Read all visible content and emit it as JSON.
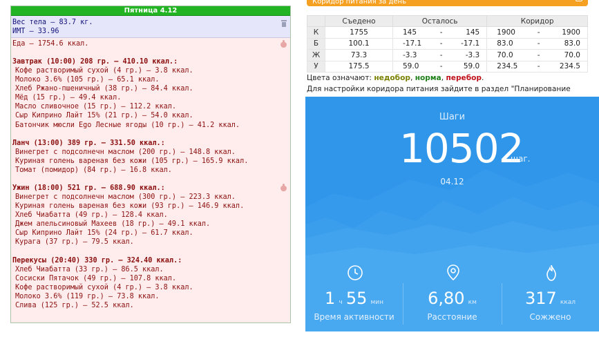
{
  "day": {
    "title": "Пятница 4.12"
  },
  "body": {
    "weight": "Вес тела — 83.7 кг.",
    "bmi": "ИМТ — 33.96"
  },
  "food": {
    "total": "Еда — 1754.6 ккал.",
    "meals": [
      {
        "header": "Завтрак (10:00) 208 гр. — 410.10 ккал.:",
        "items": [
          "Кофе растворимый сухой (4 гр.) — 3.8 ккал.",
          "Молоко 3.6% (105 гр.) — 65.1 ккал.",
          "Хлеб Ржано-пшеничный (38 гр.) — 84.4 ккал.",
          "Мёд (15 гр.) — 49.4 ккал.",
          "Масло сливочное (15 гр.) — 112.2 ккал.",
          "Сыр Киприно Лайт 15% (21 гр.) — 54.0 ккал.",
          "Батончик мюсли Ego Лесные ягоды (10 гр.) — 41.2 ккал."
        ]
      },
      {
        "header": "Ланч (13:00) 389 гр. — 331.50 ккал.:",
        "items": [
          "Винегрет с подсолнечн маслом (200 гр.) — 148.8 ккал.",
          "Куриная голень вареная без кожи (105 гр.) — 165.9 ккал.",
          "Томат (помидор) (84 гр.) — 16.8 ккал."
        ]
      },
      {
        "header": "Ужин (18:00) 521 гр. — 688.90 ккал.:",
        "items": [
          "Винегрет с подсолнечн маслом (300 гр.) — 223.3 ккал.",
          "Куриная голень вареная без кожи (93 гр.) — 146.9 ккал.",
          "Хлеб Чиабатта (49 гр.) — 128.4 ккал.",
          "Джем апельсиновый Махеев (18 гр.) — 49.1 ккал.",
          "Сыр Киприно Лайт 15% (24 гр.) — 61.7 ккал.",
          "Курага (37 гр.) — 79.5 ккал."
        ]
      },
      {
        "header": "Перекусы (20:40) 330 гр. — 324.40 ккал.:",
        "items": [
          "Хлеб Чиабатта (33 гр.) — 86.5 ккал.",
          "Сосиски Пятачок (49 гр.) — 107.8 ккал.",
          "Кофе растворимый сухой (4 гр.) — 3.8 ккал.",
          "Молоко 3.6% (119 гр.) — 73.8 ккал.",
          "Слива (125 гр.) — 52.5 ккал."
        ]
      }
    ]
  },
  "corridor_bar": {
    "label": "Коридор питания за день"
  },
  "nutrition": {
    "headers": [
      "",
      "Съедено",
      "Осталось",
      "Коридор"
    ],
    "rows": [
      {
        "key": "К",
        "eaten": "1755",
        "status": "under",
        "left_from": "145",
        "left_to": "145",
        "corr_from": "1900",
        "corr_to": "1900"
      },
      {
        "key": "Б",
        "eaten": "100.1",
        "status": "over",
        "left_from": "-17.1",
        "left_to": "-17.1",
        "corr_from": "83.0",
        "corr_to": "83.0"
      },
      {
        "key": "Ж",
        "eaten": "73.3",
        "status": "over",
        "left_from": "-3.3",
        "left_to": "-3.3",
        "corr_from": "70.0",
        "corr_to": "70.0"
      },
      {
        "key": "У",
        "eaten": "175.5",
        "status": "under",
        "left_from": "59.0",
        "left_to": "59.0",
        "corr_from": "234.5",
        "corr_to": "234.5"
      }
    ],
    "dash": "-"
  },
  "legend": {
    "prefix": "Цвета означают:",
    "under": "недобор",
    "norm": "норма",
    "over": "перебор",
    "sep": ",",
    "end": "."
  },
  "hint": "Для настройки коридора питания зайдите в раздел \"Планирование",
  "colors": {
    "under": "#7a8000",
    "norm": "#20801a",
    "over": "#c0101a",
    "steps_bg": "#2f96ea",
    "day_bar": "#22b422"
  },
  "steps": {
    "label": "Шаги",
    "value": "10502",
    "unit": "шаг.",
    "date": "04.12",
    "stats": [
      {
        "icon": "clock-icon",
        "value_a": "1",
        "unit_a": "ч",
        "value_b": "55",
        "unit_b": "мин",
        "label": "Время активности"
      },
      {
        "icon": "location-pin-icon",
        "value_a": "6,80",
        "unit_a": "км",
        "label": "Расстояние"
      },
      {
        "icon": "flame-icon",
        "value_a": "317",
        "unit_a": "ккал",
        "label": "Сожжено"
      }
    ]
  }
}
